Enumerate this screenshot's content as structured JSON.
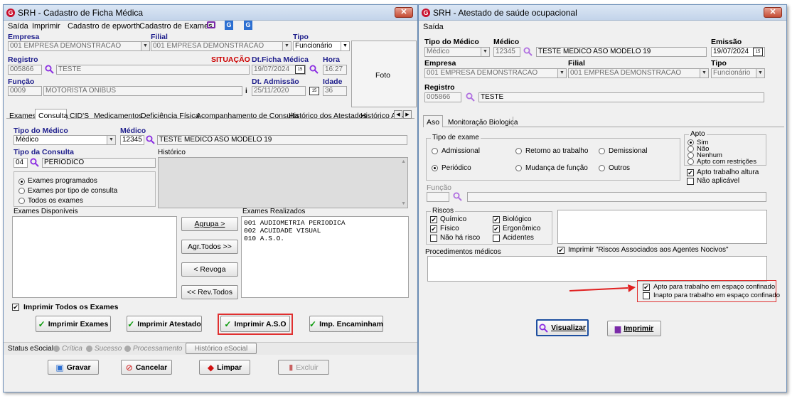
{
  "left": {
    "title": "SRH - Cadastro de Ficha Médica",
    "menu": [
      "Saída",
      "Imprimir",
      "Cadastro de epworth",
      "Cadastro de Exames"
    ],
    "empresa_label": "Empresa",
    "empresa_value": "001 EMPRESA DEMONSTRACAO",
    "filial_label": "Filial",
    "filial_value": "001 EMPRESA DEMONSTRACAO",
    "tipo_label": "Tipo",
    "tipo_value": "Funcionário",
    "registro_label": "Registro",
    "registro_code": "005866",
    "registro_name": "TESTE",
    "situacao_label": "SITUAÇÃO",
    "dt_ficha_label": "Dt.Ficha Médica",
    "dt_ficha_value": "19/07/2024",
    "hora_label": "Hora",
    "hora_value": "16:27",
    "foto_label": "Foto",
    "funcao_label": "Função",
    "funcao_code": "0009",
    "funcao_name": "MOTORISTA ONIBUS",
    "dt_admissao_label": "Dt. Admissão",
    "dt_admissao_value": "25/11/2020",
    "idade_label": "Idade",
    "idade_value": "36",
    "tabs": [
      "Exames",
      "Consulta",
      "CID'S",
      "Medicamentos",
      "Deficiência Física",
      "Acompanhamento de Consulta",
      "Histórico dos Atestados",
      "Histórico A.S"
    ],
    "tipo_medico_label": "Tipo do Médico",
    "tipo_medico_value": "Médico",
    "medico_label": "Médico",
    "medico_code": "12345",
    "medico_name": "TESTE MEDICO ASO MODELO 19",
    "tipo_consulta_label": "Tipo da Consulta",
    "tipo_consulta_code": "04",
    "tipo_consulta_name": "PERIÓDICO",
    "historico_label": "Histórico",
    "radio_options": [
      "Exames programados",
      "Exames por tipo de consulta",
      "Todos os exames"
    ],
    "exames_disponiveis_label": "Exames Disponíveis",
    "exames_realizados_label": "Exames Realizados",
    "exames_realizados": [
      "001 AUDIOMETRIA PERIODICA",
      "002 ACUIDADE VISUAL",
      "010 A.S.O."
    ],
    "mid_buttons": [
      "Agrupa >",
      "Agr.Todos >>",
      "< Revoga",
      "<< Rev.Todos"
    ],
    "imprimir_todos_label": "Imprimir Todos os Exames",
    "action_buttons": [
      "Imprimir Exames",
      "Imprimir Atestado",
      "Imprimir A.S.O",
      "Imp. Encaminham"
    ],
    "status_esocial_label": "Status eSocial:",
    "status_items": [
      "Crítica",
      "Sucesso",
      "Processamento"
    ],
    "historico_esocial": "Histórico eSocial",
    "bottom_buttons": [
      "Gravar",
      "Cancelar",
      "Limpar",
      "Excluir"
    ]
  },
  "right": {
    "title": "SRH - Atestado de saúde ocupacional",
    "menu": [
      "Saída"
    ],
    "tipo_medico_label": "Tipo do Médico",
    "tipo_medico_value": "Médico",
    "medico_label": "Médico",
    "medico_code": "12345",
    "medico_name": "TESTE MEDICO ASO MODELO 19",
    "emissao_label": "Emissão",
    "emissao_value": "19/07/2024",
    "empresa_label": "Empresa",
    "empresa_value": "001 EMPRESA DEMONSTRACAO",
    "filial_label": "Filial",
    "filial_value": "001 EMPRESA DEMONSTRACAO",
    "tipo_label": "Tipo",
    "tipo_value": "Funcionário",
    "registro_label": "Registro",
    "registro_code": "005866",
    "registro_name": "TESTE",
    "tabs": [
      "Aso",
      "Monitoração Biologica"
    ],
    "tipo_exame_label": "Tipo de exame",
    "tipo_exame_options": [
      "Admissional",
      "Retorno ao trabalho",
      "Demissional",
      "Periódico",
      "Mudança de função",
      "Outros"
    ],
    "apto_label": "Apto",
    "apto_options": [
      "Sim",
      "Não",
      "Nenhum",
      "Apto com restrições"
    ],
    "apto_altura": "Apto trabalho altura",
    "nao_aplicavel": "Não aplicável",
    "funcao_label": "Função",
    "riscos_label": "Riscos",
    "riscos": [
      "Químico",
      "Biológico",
      "Físico",
      "Ergonômico",
      "Não há risco",
      "Acidentes"
    ],
    "procedimentos_label": "Procedimentos médicos",
    "imprimir_riscos": "Imprimir  \"Riscos Associados aos Agentes Nocivos\"",
    "apto_confinado": "Apto para trabalho em espaço confinado",
    "inapto_confinado": "Inapto para trabalho em espaço confinado",
    "visualizar": "Visualizar",
    "imprimir": "Imprimir"
  },
  "colors": {
    "label_blue": "#1e1e8c",
    "situacao_red": "#cc0000",
    "highlight_red": "#e03030",
    "check_green": "#0a9a0a"
  }
}
